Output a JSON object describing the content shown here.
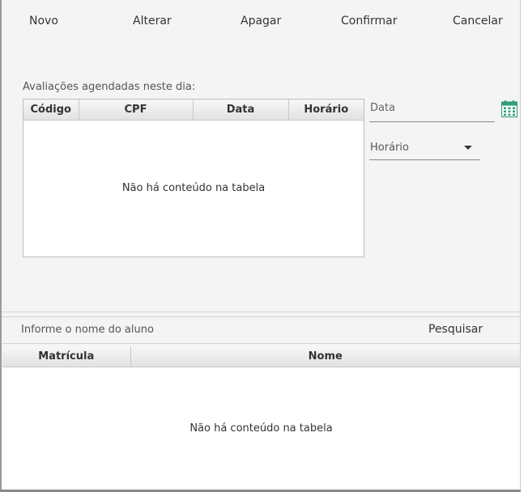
{
  "toolbar": {
    "novo": "Novo",
    "alterar": "Alterar",
    "apagar": "Apagar",
    "confirmar": "Confirmar",
    "cancelar": "Cancelar"
  },
  "scheduled": {
    "label": "Avaliações agendadas neste dia:",
    "columns": [
      "Código",
      "CPF",
      "Data",
      "Horário"
    ],
    "empty_message": "Não há conteúdo na tabela"
  },
  "form": {
    "date_label": "Data",
    "time_label": "Horário",
    "calendar_icon": "calendar-icon",
    "accent_color": "#2e9e78"
  },
  "search": {
    "placeholder": "Informe o nome do aluno",
    "button": "Pesquisar"
  },
  "students": {
    "columns": [
      "Matrícula",
      "Nome"
    ],
    "empty_message": "Não há conteúdo na tabela"
  }
}
